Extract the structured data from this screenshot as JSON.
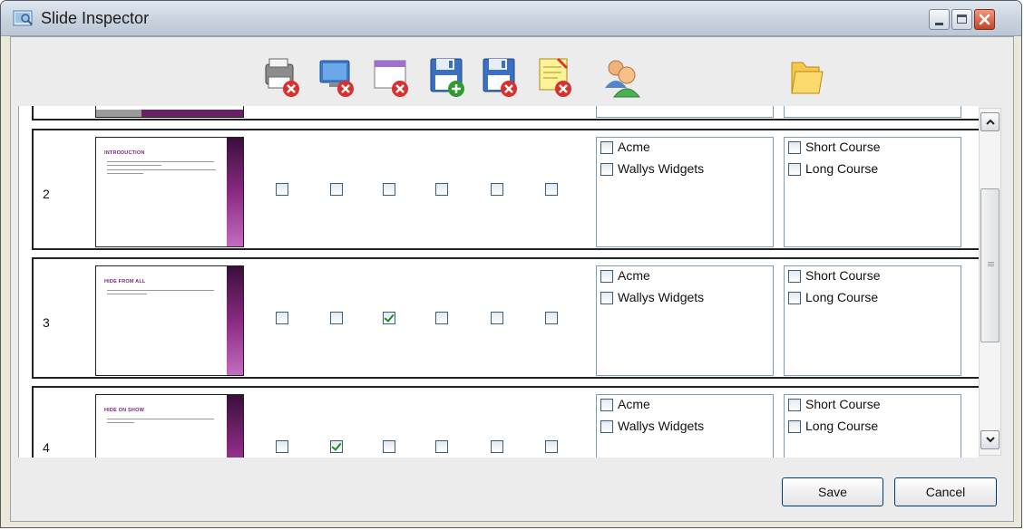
{
  "window": {
    "title": "Slide Inspector"
  },
  "toolbar": {
    "icons": [
      "printer-remove-icon",
      "monitor-remove-icon",
      "window-remove-icon",
      "save-add-icon",
      "save-remove-icon",
      "notes-remove-icon",
      "users-icon",
      "folder-icon"
    ]
  },
  "rows": [
    {
      "number": "2",
      "slide_title": "INTRODUCTION",
      "checks": [
        false,
        false,
        false,
        false,
        false,
        false
      ],
      "companies": [
        {
          "label": "Acme",
          "checked": false
        },
        {
          "label": "Wallys Widgets",
          "checked": false
        }
      ],
      "courses": [
        {
          "label": "Short Course",
          "checked": false
        },
        {
          "label": "Long Course",
          "checked": false
        }
      ]
    },
    {
      "number": "3",
      "slide_title": "HIDE FROM ALL",
      "checks": [
        false,
        false,
        true,
        false,
        false,
        false
      ],
      "companies": [
        {
          "label": "Acme",
          "checked": false
        },
        {
          "label": "Wallys Widgets",
          "checked": false
        }
      ],
      "courses": [
        {
          "label": "Short Course",
          "checked": false
        },
        {
          "label": "Long Course",
          "checked": false
        }
      ]
    },
    {
      "number": "4",
      "slide_title": "HIDE ON SHOW",
      "checks": [
        false,
        true,
        false,
        false,
        false,
        false
      ],
      "companies": [
        {
          "label": "Acme",
          "checked": false
        },
        {
          "label": "Wallys Widgets",
          "checked": false
        }
      ],
      "courses": [
        {
          "label": "Short Course",
          "checked": false
        },
        {
          "label": "Long Course",
          "checked": false
        }
      ]
    }
  ],
  "buttons": {
    "save": "Save",
    "cancel": "Cancel"
  },
  "colors": {
    "accent": "#8a2a82",
    "checkbox_border": "#3a5e7a",
    "check_mark": "#1f8c1f"
  }
}
